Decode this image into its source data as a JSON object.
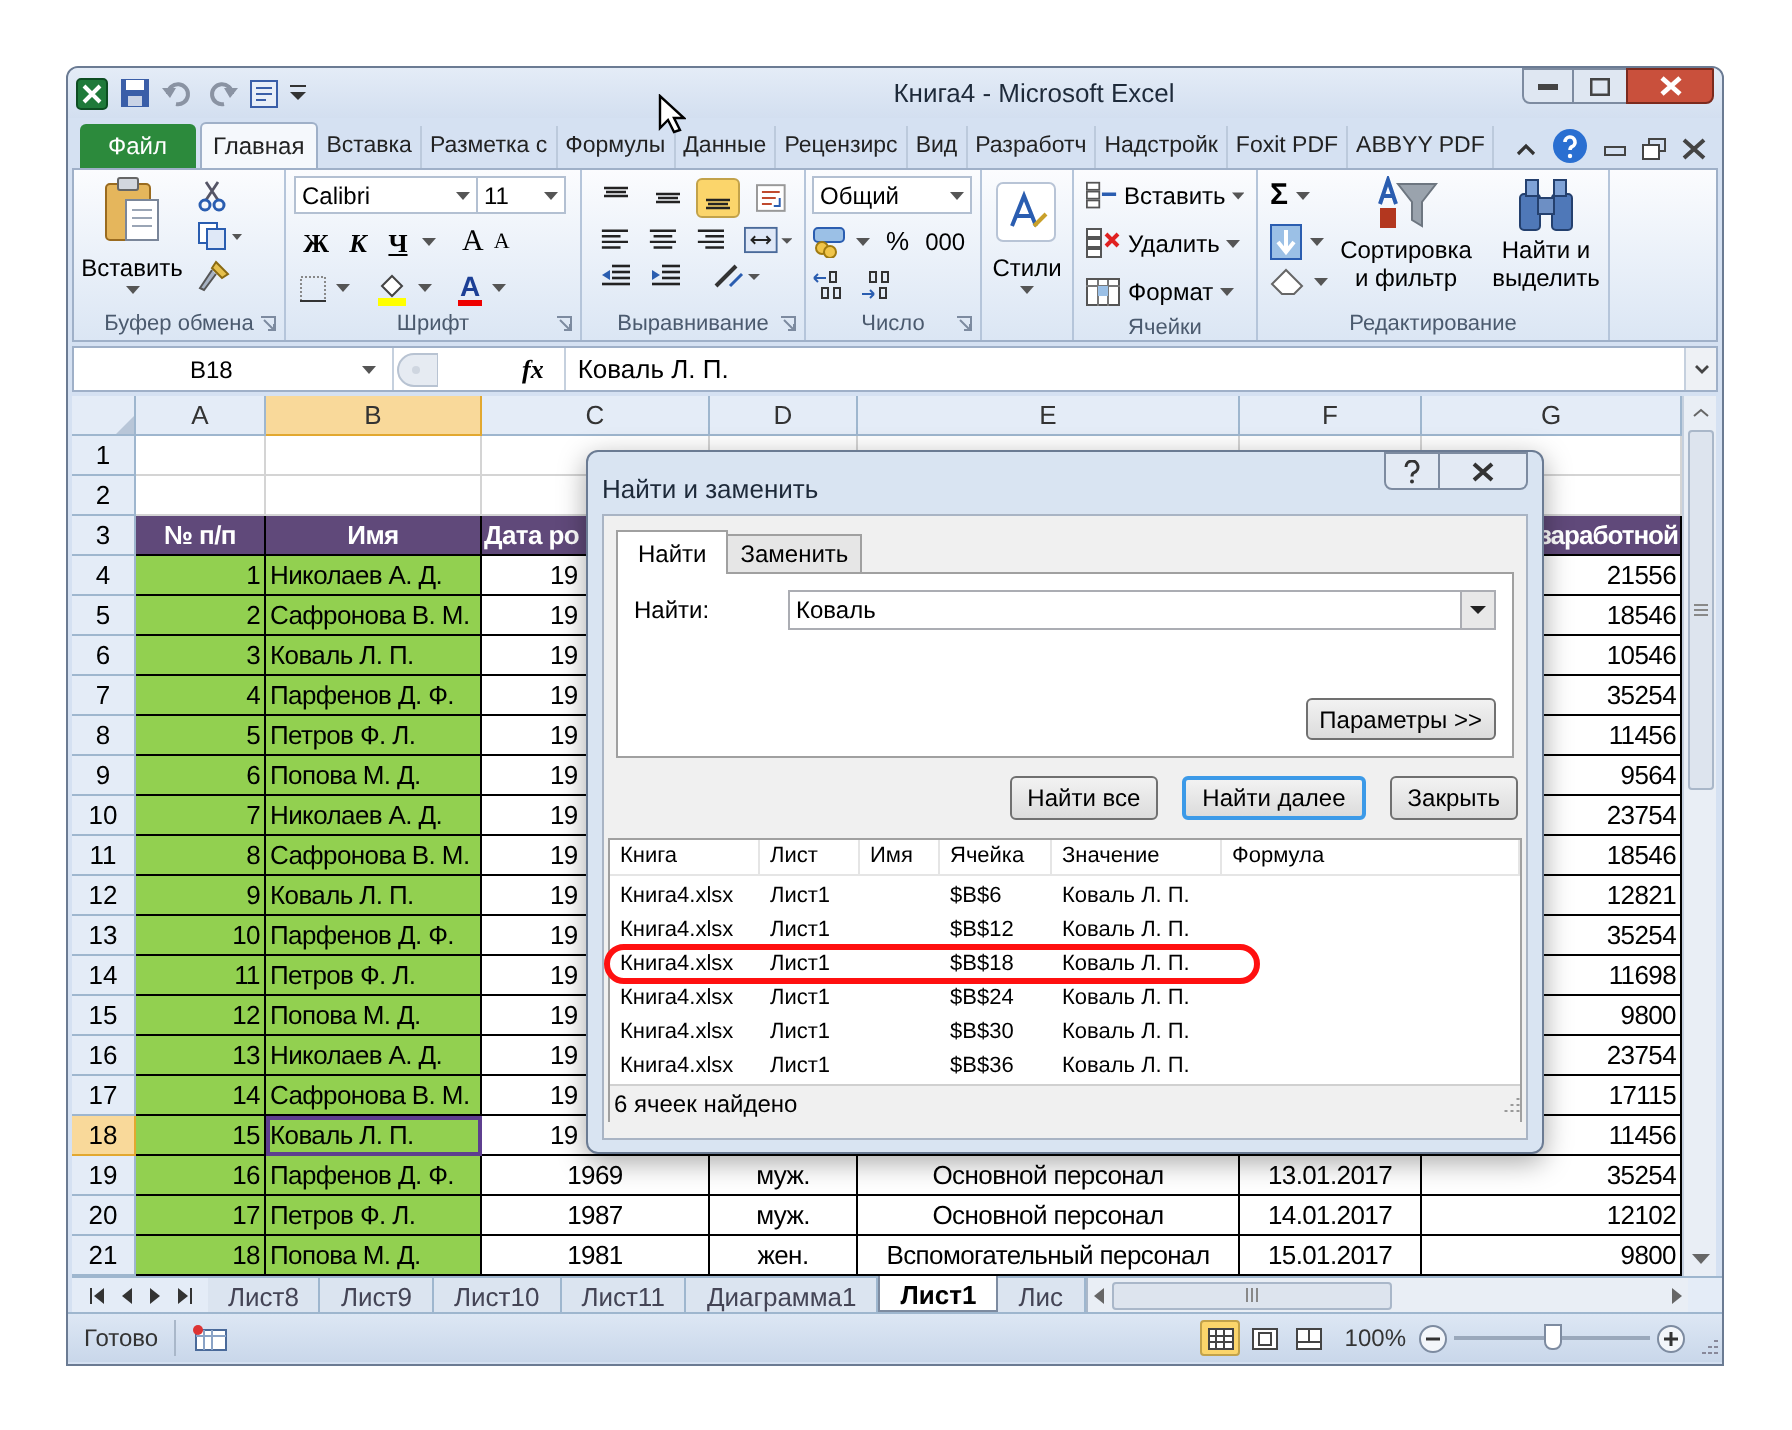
{
  "window": {
    "title": "Книга4  -  Microsoft Excel"
  },
  "ribbon_tabs": [
    {
      "label": "Файл",
      "kind": "file",
      "selected": false
    },
    {
      "label": "Главная",
      "kind": "tab",
      "selected": true
    },
    {
      "label": "Вставка",
      "kind": "tab",
      "selected": false
    },
    {
      "label": "Разметка с",
      "kind": "tab",
      "selected": false
    },
    {
      "label": "Формулы",
      "kind": "tab",
      "selected": false
    },
    {
      "label": "Данные",
      "kind": "tab",
      "selected": false
    },
    {
      "label": "Рецензирс",
      "kind": "tab",
      "selected": false
    },
    {
      "label": "Вид",
      "kind": "tab",
      "selected": false
    },
    {
      "label": "Разработч",
      "kind": "tab",
      "selected": false
    },
    {
      "label": "Надстройк",
      "kind": "tab",
      "selected": false
    },
    {
      "label": "Foxit PDF",
      "kind": "tab",
      "selected": false
    },
    {
      "label": "ABBYY PDF",
      "kind": "tab",
      "selected": false
    }
  ],
  "ribbon": {
    "clipboard": {
      "label": "Буфер обмена",
      "paste": "Вставить"
    },
    "font": {
      "label": "Шрифт",
      "font_name": "Calibri",
      "font_size": "11",
      "bold": "Ж",
      "italic": "К",
      "underline": "Ч",
      "grow": "A",
      "shrink": "A",
      "font_color": "A"
    },
    "alignment": {
      "label": "Выравнивание",
      "vertical": [
        {
          "selected": false
        },
        {
          "selected": false
        },
        {
          "selected": true
        }
      ]
    },
    "number": {
      "label": "Число",
      "format": "Общий",
      "percent": "%",
      "thousands": "000"
    },
    "styles": {
      "label": "Стили"
    },
    "cells": {
      "label": "Ячейки",
      "insert": "Вставить",
      "delete": "Удалить",
      "format": "Формат"
    },
    "editing": {
      "label": "Редактирование",
      "sum": "Σ",
      "sort": "Сортировка и фильтр",
      "find": "Найти и выделить"
    }
  },
  "formula_bar": {
    "name_box": "B18",
    "fx": "fx",
    "value": "Коваль Л. П."
  },
  "sheet": {
    "columns": [
      {
        "label": "A",
        "selected": false
      },
      {
        "label": "B",
        "selected": true
      },
      {
        "label": "C",
        "selected": false
      },
      {
        "label": "D",
        "selected": false
      },
      {
        "label": "E",
        "selected": false
      },
      {
        "label": "F",
        "selected": false
      },
      {
        "label": "G",
        "selected": false
      }
    ],
    "rows": [
      {
        "number": "1",
        "kind": "empty",
        "selected": false
      },
      {
        "number": "2",
        "kind": "empty",
        "selected": false
      },
      {
        "number": "3",
        "kind": "header",
        "selected": false,
        "a": "№ п/п",
        "b": "Имя",
        "c": "Дата ро",
        "g": "заработной"
      },
      {
        "number": "4",
        "kind": "data",
        "selected": false,
        "a": "1",
        "b": "Николаев А. Д.",
        "c": "19",
        "g": "21556"
      },
      {
        "number": "5",
        "kind": "data",
        "selected": false,
        "a": "2",
        "b": "Сафронова В. М.",
        "c": "19",
        "g": "18546"
      },
      {
        "number": "6",
        "kind": "data",
        "selected": false,
        "a": "3",
        "b": "Коваль Л. П.",
        "c": "19",
        "g": "10546"
      },
      {
        "number": "7",
        "kind": "data",
        "selected": false,
        "a": "4",
        "b": "Парфенов Д. Ф.",
        "c": "19",
        "g": "35254"
      },
      {
        "number": "8",
        "kind": "data",
        "selected": false,
        "a": "5",
        "b": "Петров Ф. Л.",
        "c": "19",
        "g": "11456"
      },
      {
        "number": "9",
        "kind": "data",
        "selected": false,
        "a": "6",
        "b": "Попова М. Д.",
        "c": "19",
        "g": "9564"
      },
      {
        "number": "10",
        "kind": "data",
        "selected": false,
        "a": "7",
        "b": "Николаев А. Д.",
        "c": "19",
        "g": "23754"
      },
      {
        "number": "11",
        "kind": "data",
        "selected": false,
        "a": "8",
        "b": "Сафронова В. М.",
        "c": "19",
        "g": "18546"
      },
      {
        "number": "12",
        "kind": "data",
        "selected": false,
        "a": "9",
        "b": "Коваль Л. П.",
        "c": "19",
        "g": "12821"
      },
      {
        "number": "13",
        "kind": "data",
        "selected": false,
        "a": "10",
        "b": "Парфенов Д. Ф.",
        "c": "19",
        "g": "35254"
      },
      {
        "number": "14",
        "kind": "data",
        "selected": false,
        "a": "11",
        "b": "Петров Ф. Л.",
        "c": "19",
        "g": "11698"
      },
      {
        "number": "15",
        "kind": "data",
        "selected": false,
        "a": "12",
        "b": "Попова М. Д.",
        "c": "19",
        "g": "9800"
      },
      {
        "number": "16",
        "kind": "data",
        "selected": false,
        "a": "13",
        "b": "Николаев А. Д.",
        "c": "19",
        "g": "23754"
      },
      {
        "number": "17",
        "kind": "data",
        "selected": false,
        "a": "14",
        "b": "Сафронова В. М.",
        "c": "19",
        "g": "17115"
      },
      {
        "number": "18",
        "kind": "data",
        "selected": true,
        "a": "15",
        "b": "Коваль Л. П.",
        "c": "19",
        "g": "11456"
      },
      {
        "number": "19",
        "kind": "data",
        "selected": false,
        "a": "16",
        "b": "Парфенов Д. Ф.",
        "c": "1969",
        "d": "муж.",
        "e": "Основной персонал",
        "f": "13.01.2017",
        "g": "35254"
      },
      {
        "number": "20",
        "kind": "data",
        "selected": false,
        "a": "17",
        "b": "Петров Ф. Л.",
        "c": "1987",
        "d": "муж.",
        "e": "Основной персонал",
        "f": "14.01.2017",
        "g": "12102"
      },
      {
        "number": "21",
        "kind": "data",
        "selected": false,
        "a": "18",
        "b": "Попова М. Д.",
        "c": "1981",
        "d": "жен.",
        "e": "Вспомогательный персонал",
        "f": "15.01.2017",
        "g": "9800"
      }
    ]
  },
  "find_dialog": {
    "title": "Найти и заменить",
    "tabs": [
      {
        "label": "Найти",
        "selected": true
      },
      {
        "label": "Заменить",
        "selected": false
      }
    ],
    "find_label": "Найти:",
    "find_value": "Коваль",
    "options_button": "Параметры >>",
    "buttons": [
      {
        "label": "Найти все",
        "default": false
      },
      {
        "label": "Найти далее",
        "default": true
      },
      {
        "label": "Закрыть",
        "default": false
      }
    ],
    "columns": [
      "Книга",
      "Лист",
      "Имя",
      "Ячейка",
      "Значение",
      "Формула"
    ],
    "results": [
      {
        "book": "Книга4.xlsx",
        "sheet": "Лист1",
        "cell": "$B$6",
        "value": "Коваль Л. П.",
        "circled": false
      },
      {
        "book": "Книга4.xlsx",
        "sheet": "Лист1",
        "cell": "$B$12",
        "value": "Коваль Л. П.",
        "circled": false
      },
      {
        "book": "Книга4.xlsx",
        "sheet": "Лист1",
        "cell": "$B$18",
        "value": "Коваль Л. П.",
        "circled": true
      },
      {
        "book": "Книга4.xlsx",
        "sheet": "Лист1",
        "cell": "$B$24",
        "value": "Коваль Л. П.",
        "circled": false
      },
      {
        "book": "Книга4.xlsx",
        "sheet": "Лист1",
        "cell": "$B$30",
        "value": "Коваль Л. П.",
        "circled": false
      },
      {
        "book": "Книга4.xlsx",
        "sheet": "Лист1",
        "cell": "$B$36",
        "value": "Коваль Л. П.",
        "circled": false
      }
    ],
    "status": "6 ячеек найдено"
  },
  "sheet_tabs": [
    {
      "label": "Лист8",
      "selected": false
    },
    {
      "label": "Лист9",
      "selected": false
    },
    {
      "label": "Лист10",
      "selected": false
    },
    {
      "label": "Лист11",
      "selected": false
    },
    {
      "label": "Диаграмма1",
      "selected": false
    },
    {
      "label": "Лист1",
      "selected": true
    },
    {
      "label": "Лис",
      "selected": false
    }
  ],
  "status_bar": {
    "status": "Готово",
    "views": [
      {
        "kind": "normal",
        "selected": true
      },
      {
        "kind": "page_layout",
        "selected": false
      },
      {
        "kind": "page_break",
        "selected": false
      }
    ],
    "zoom": "100%",
    "zoom_slider": {
      "level": 0.5
    }
  }
}
